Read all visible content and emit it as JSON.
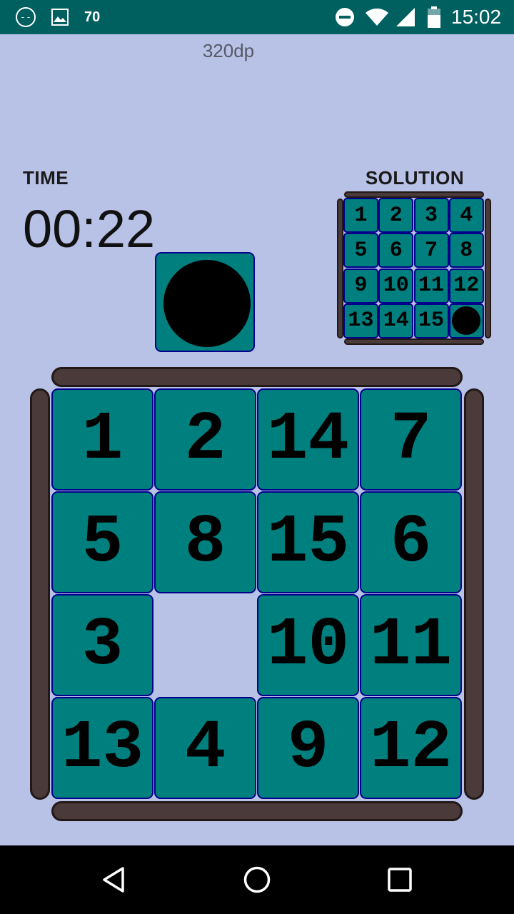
{
  "status_bar": {
    "notification_count": "70",
    "time": "15:02",
    "icons": [
      "app-notification-icon",
      "image-icon",
      "do-not-disturb-icon",
      "wifi-icon",
      "cell-signal-icon",
      "battery-icon"
    ]
  },
  "header": {
    "dp_label": "320dp"
  },
  "timer": {
    "label": "TIME",
    "value": "00:22"
  },
  "solution": {
    "label": "SOLUTION",
    "tiles": [
      "1",
      "2",
      "3",
      "4",
      "5",
      "6",
      "7",
      "8",
      "9",
      "10",
      "11",
      "12",
      "13",
      "14",
      "15",
      ""
    ],
    "empty_icon": "ball-icon"
  },
  "preview": {
    "icon": "ball-icon"
  },
  "board": {
    "tiles": [
      "1",
      "2",
      "14",
      "7",
      "5",
      "8",
      "15",
      "6",
      "3",
      "",
      "10",
      "11",
      "13",
      "4",
      "9",
      "12"
    ],
    "empty_index": 9
  },
  "colors": {
    "background": "#b8c1e6",
    "tile": "#007f7f",
    "tile_border": "#00008b",
    "rail": "#4a3a3a",
    "status_bar": "#005f5f"
  },
  "navigation": {
    "icons": [
      "back-icon",
      "home-icon",
      "recents-icon"
    ]
  }
}
